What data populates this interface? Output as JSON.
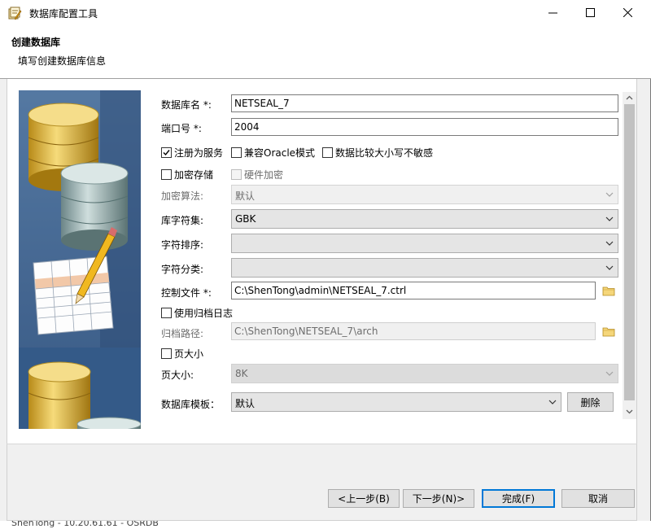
{
  "window": {
    "title": "数据库配置工具"
  },
  "header": {
    "title": "创建数据库",
    "subtitle": "填写创建数据库信息"
  },
  "form": {
    "db_name": {
      "label": "数据库名 *:",
      "value": "NETSEAL_7"
    },
    "port": {
      "label": "端口号 *:",
      "value": "2004"
    },
    "register_service": {
      "label": "注册为服务",
      "checked": true
    },
    "oracle_compat": {
      "label": "兼容Oracle模式",
      "checked": false
    },
    "case_insensitive": {
      "label": "数据比较大小写不敏感",
      "checked": false
    },
    "encrypt_storage": {
      "label": "加密存储",
      "checked": false
    },
    "hardware_encrypt": {
      "label": "硬件加密",
      "checked": false
    },
    "encrypt_algo": {
      "label": "加密算法:",
      "value": "默认"
    },
    "charset": {
      "label": "库字符集:",
      "value": "GBK"
    },
    "collation": {
      "label": "字符排序:",
      "value": ""
    },
    "char_class": {
      "label": "字符分类:",
      "value": ""
    },
    "control_file": {
      "label": "控制文件 *:",
      "value": "C:\\ShenTong\\admin\\NETSEAL_7.ctrl"
    },
    "use_archive": {
      "label": "使用归档日志",
      "checked": false
    },
    "archive_path": {
      "label": "归档路径:",
      "value": "C:\\ShenTong\\NETSEAL_7\\arch"
    },
    "page_size_chk": {
      "label": "页大小",
      "checked": false
    },
    "page_size": {
      "label": "页大小:",
      "value": "8K"
    },
    "template": {
      "label": "数据库模板：",
      "value": "默认"
    },
    "delete_label": "删除"
  },
  "buttons": {
    "back": "<上一步(B)",
    "next": "下一步(N)>",
    "finish": "完成(F)",
    "cancel": "取消"
  },
  "status": {
    "text": "ShenTong - 10.20.61.61 - OSRDB"
  },
  "colors": {
    "accent": "#0078d7"
  }
}
